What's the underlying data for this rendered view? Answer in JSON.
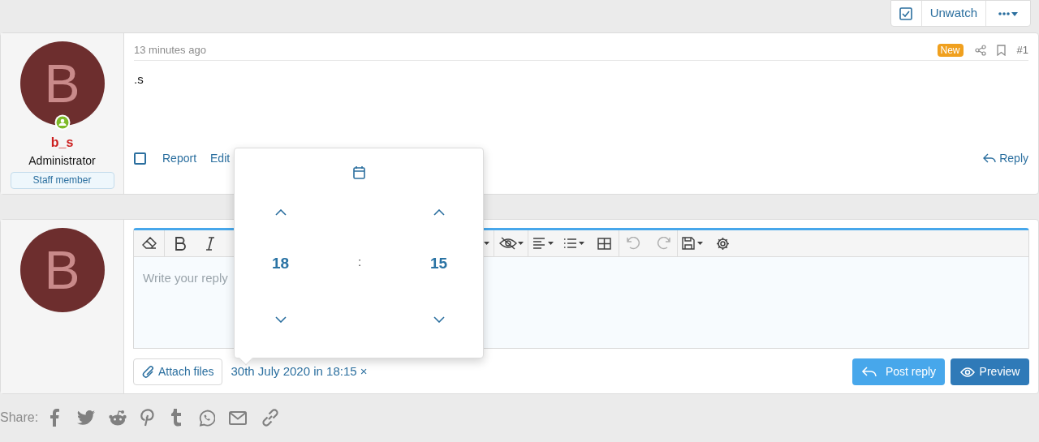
{
  "thread_controls": {
    "watch": {
      "checked": true,
      "label": "Unwatch"
    }
  },
  "post": {
    "author": {
      "avatar_letter": "B",
      "online": true,
      "name": "b_s",
      "title": "Administrator",
      "badge": "Staff member"
    },
    "time": "13 minutes ago",
    "new_badge": "New",
    "number": "#1",
    "body": ".s",
    "selected": false,
    "actions": [
      "Report",
      "Edit"
    ],
    "reply": "Reply"
  },
  "reply_form": {
    "avatar_letter": "B",
    "placeholder": "Write your reply",
    "attach": "Attach files",
    "schedule": "30th July 2020 in 18:15",
    "schedule_clear": "×",
    "post_button": "Post reply",
    "preview_button": "Preview"
  },
  "time_picker": {
    "hour": "18",
    "separator": ":",
    "minute": "15"
  },
  "share": {
    "label": "Share:"
  }
}
